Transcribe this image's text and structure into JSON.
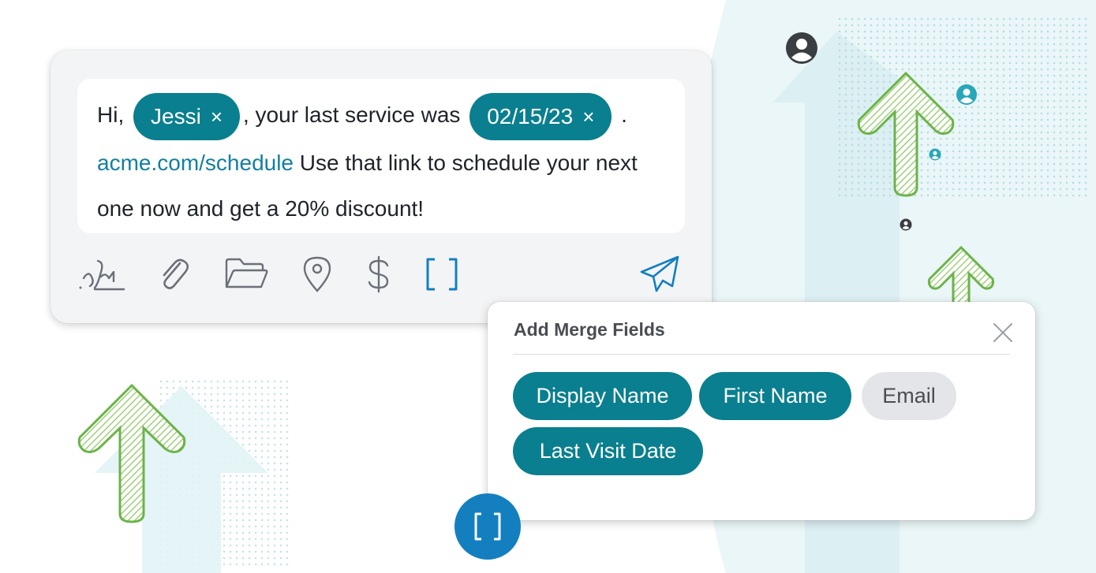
{
  "message": {
    "greeting": "Hi,",
    "chip_name": "Jessi",
    "middle": ", your last service was",
    "chip_date": "02/15/23",
    "period": ".",
    "link": "acme.com/schedule",
    "rest": "Use that link to schedule your next one now and get a 20% discount!"
  },
  "toolbar": {
    "icons": [
      "signature-icon",
      "paperclip-icon",
      "folder-icon",
      "location-pin-icon",
      "dollar-icon",
      "merge-field-brackets-icon",
      "send-icon"
    ]
  },
  "merge_panel": {
    "title": "Add Merge Fields",
    "fields": [
      {
        "label": "Display Name",
        "selected": true
      },
      {
        "label": "First Name",
        "selected": true
      },
      {
        "label": "Email",
        "selected": false
      },
      {
        "label": "Last Visit Date",
        "selected": true
      }
    ]
  },
  "colors": {
    "chip": "#0a7f8f",
    "link": "#137fa0",
    "accent_blue": "#137fbf",
    "arrow_green": "#7cbf5a"
  },
  "remove_glyph": "×"
}
